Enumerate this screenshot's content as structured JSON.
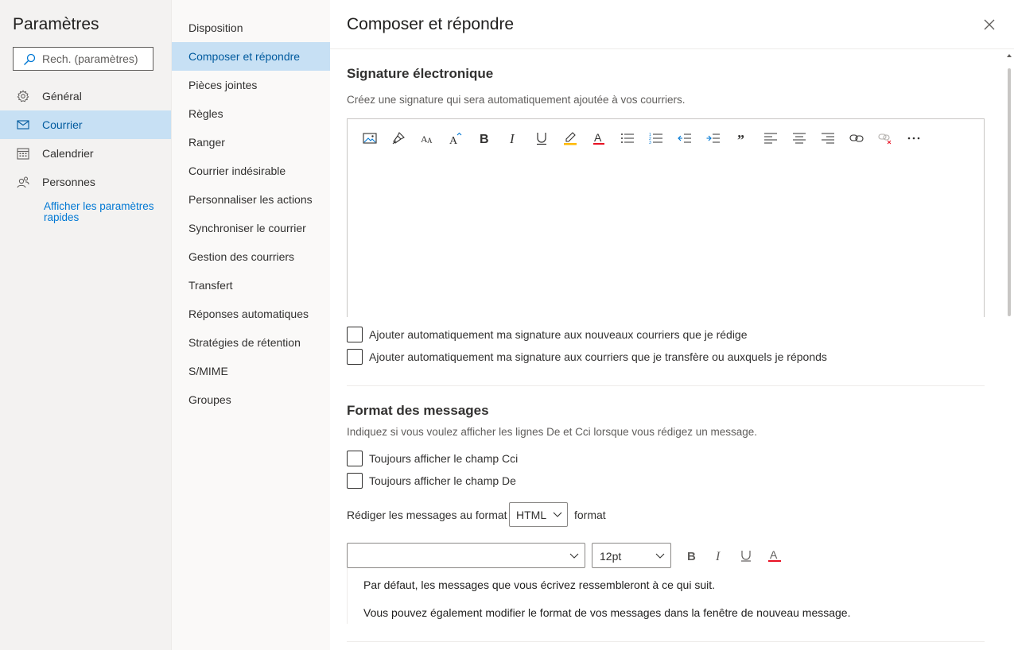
{
  "settings": {
    "title": "Paramètres",
    "search_placeholder": "Rech. (paramètres)",
    "nav": [
      {
        "label": "Général",
        "icon": "gear-icon"
      },
      {
        "label": "Courrier",
        "icon": "mail-icon",
        "active": true
      },
      {
        "label": "Calendrier",
        "icon": "calendar-icon"
      },
      {
        "label": "Personnes",
        "icon": "people-icon"
      }
    ],
    "quick_settings_link": "Afficher les paramètres rapides"
  },
  "mail_menu": {
    "items": [
      "Disposition",
      "Composer et répondre",
      "Pièces jointes",
      "Règles",
      "Ranger",
      "Courrier indésirable",
      "Personnaliser les actions",
      "Synchroniser le courrier",
      "Gestion des courriers",
      "Transfert",
      "Réponses automatiques",
      "Stratégies de rétention",
      "S/MIME",
      "Groupes"
    ],
    "active_index": 1
  },
  "panel": {
    "title": "Composer et répondre",
    "signature": {
      "heading": "Signature électronique",
      "description": "Créez une signature qui sera automatiquement ajoutée à vos courriers.",
      "toolbar_icons": [
        "insert-image-icon",
        "format-painter-icon",
        "font-size-icon",
        "grow-font-icon",
        "bold-icon",
        "italic-icon",
        "underline-icon",
        "highlight-icon",
        "font-color-icon",
        "bullets-icon",
        "numbering-icon",
        "decrease-indent-icon",
        "increase-indent-icon",
        "quote-icon",
        "align-left-icon",
        "align-center-icon",
        "align-right-icon",
        "insert-link-icon",
        "remove-link-icon",
        "more-options-icon"
      ],
      "checkbox_new": "Ajouter automatiquement ma signature aux nouveaux courriers que je rédige",
      "checkbox_reply": "Ajouter automatiquement ma signature aux courriers que je transfère ou auxquels je réponds"
    },
    "message_format": {
      "heading": "Format des messages",
      "description": "Indiquez si vous voulez afficher les lignes De et Cci lorsque vous rédigez un message.",
      "checkbox_bcc": "Toujours afficher le champ Cci",
      "checkbox_from": "Toujours afficher le champ De",
      "compose_prefix": "Rédiger les messages au format",
      "compose_format": "HTML",
      "compose_suffix": "format",
      "font_name": "",
      "font_size": "12pt",
      "font_color": "#e81123",
      "preview_line1": "Par défaut, les messages que vous écrivez ressembleront à ce qui suit.",
      "preview_line2": "Vous pouvez également modifier le format de vos messages dans la fenêtre de nouveau message."
    }
  },
  "colors": {
    "accent": "#0078d4",
    "active_bg": "#c7e0f4",
    "highlight": "#ffb900",
    "font_color": "#e81123"
  }
}
